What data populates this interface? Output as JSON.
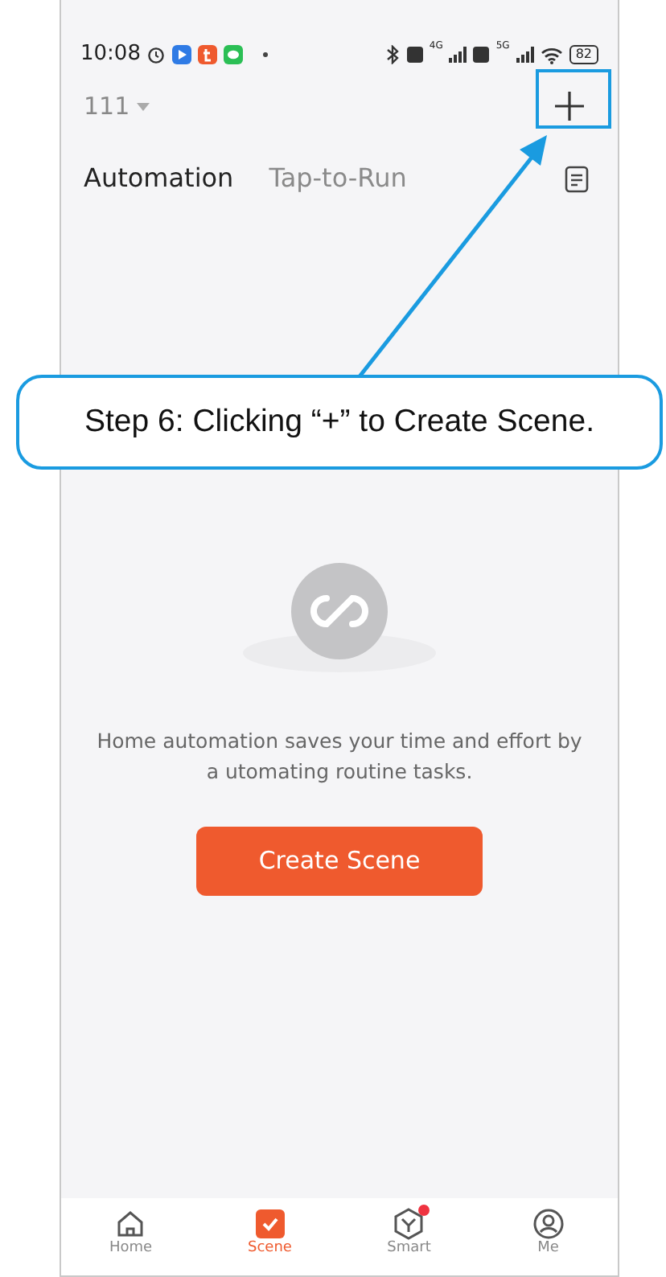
{
  "status_bar": {
    "time": "10:08",
    "network_1": "4G",
    "network_2": "5G",
    "battery": "82"
  },
  "home_selector": {
    "label": "111"
  },
  "tabs": [
    {
      "label": "Automation",
      "selected": true
    },
    {
      "label": "Tap-to-Run",
      "selected": false
    }
  ],
  "empty_state": {
    "message": "Home automation saves your time and effort by a utomating routine tasks.",
    "button": "Create Scene"
  },
  "bottom_nav": [
    {
      "kind": "home",
      "label": "Home",
      "selected": false,
      "dot": false
    },
    {
      "kind": "scene",
      "label": "Scene",
      "selected": true,
      "dot": false
    },
    {
      "kind": "smart",
      "label": "Smart",
      "selected": false,
      "dot": true
    },
    {
      "kind": "me",
      "label": "Me",
      "selected": false,
      "dot": false
    }
  ],
  "callout": {
    "text": "Step 6: Clicking “+” to Create Scene."
  }
}
